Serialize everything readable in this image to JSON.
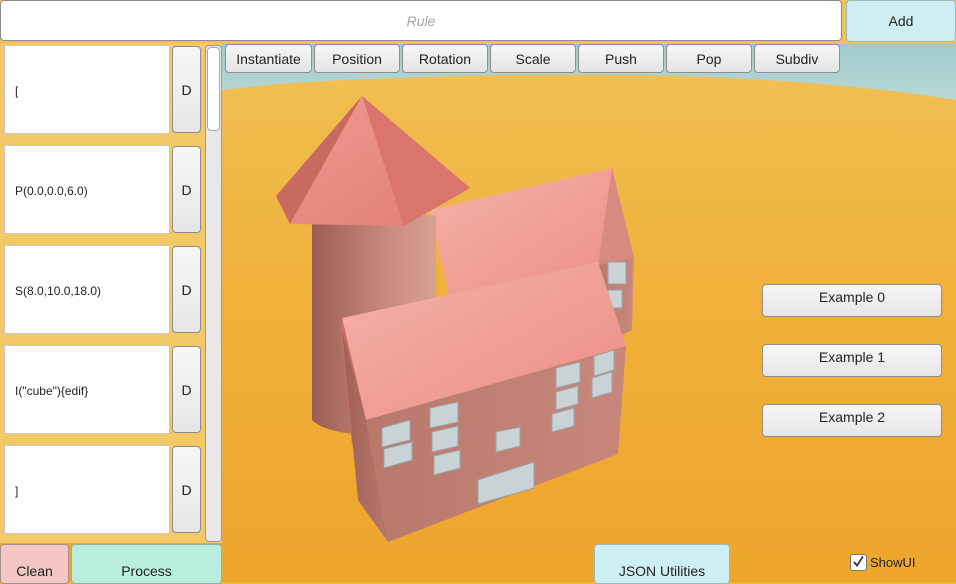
{
  "rule_bar": {
    "placeholder": "Rule",
    "add_label": "Add"
  },
  "toolbar": {
    "buttons": [
      "Instantiate",
      "Position",
      "Rotation",
      "Scale",
      "Push",
      "Pop",
      "Subdiv"
    ]
  },
  "rules": {
    "items": [
      {
        "text": "[",
        "delete_label": "D"
      },
      {
        "text": "P(0.0,0.0,6.0)",
        "delete_label": "D"
      },
      {
        "text": "S(8.0,10.0,18.0)",
        "delete_label": "D"
      },
      {
        "text": "I(\"cube\"){edif}",
        "delete_label": "D"
      },
      {
        "text": "]",
        "delete_label": "D"
      }
    ]
  },
  "bottom": {
    "clean_label": "Clean",
    "process_label": "Process",
    "json_label": "JSON Utilities"
  },
  "examples": [
    "Example 0",
    "Example 1",
    "Example 2"
  ],
  "show_ui": {
    "label": "ShowUI",
    "checked": true
  },
  "colors": {
    "ground": "#f0b43a",
    "sky": "#a7cfd2",
    "roof": "#e6837a",
    "wall": "#c9857a"
  }
}
